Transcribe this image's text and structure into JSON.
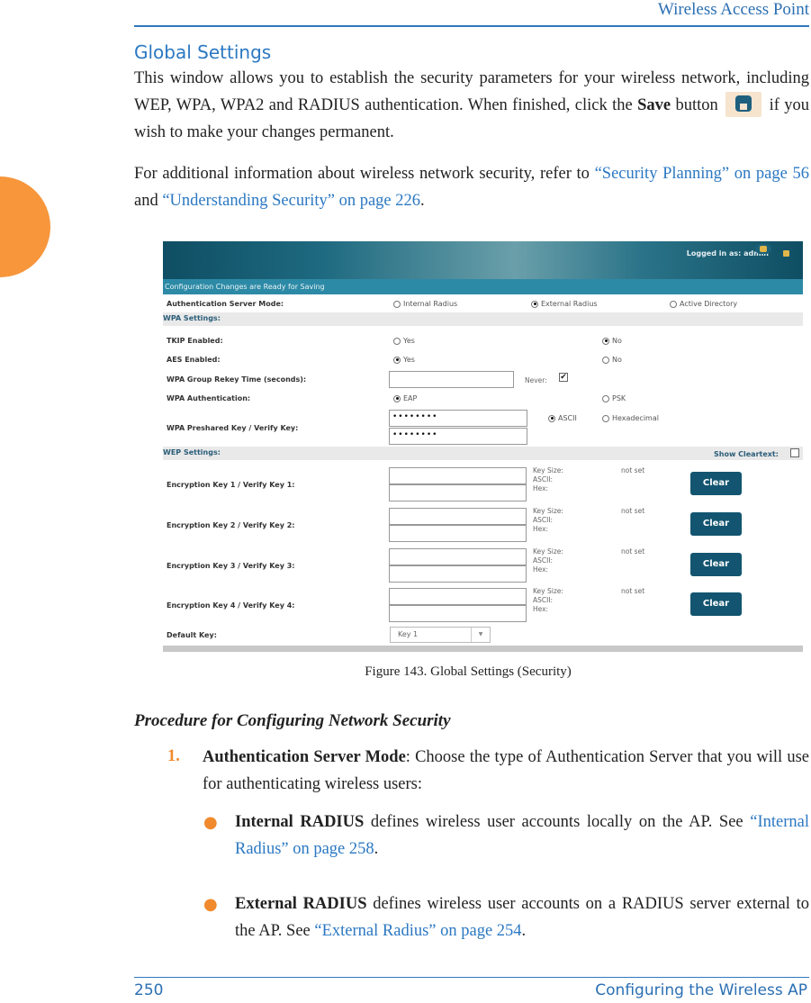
{
  "header": {
    "title": "Wireless Access Point"
  },
  "section_title": "Global Settings",
  "intro": {
    "p1_a": "This window allows you to establish the security parameters for your wireless network, including WEP, WPA, WPA2 and RADIUS authentication. When finished, click the ",
    "p1_save": "Save",
    "p1_b": " button",
    "p1_c": " if you wish to make your changes permanent.",
    "p2_a": "For additional information about wireless network security, refer to ",
    "p2_link1": "“Security Planning” on page 56",
    "p2_b": " and ",
    "p2_link2": "“Understanding Security” on page 226",
    "p2_c": "."
  },
  "figure": {
    "logged_in": "Logged in as: admin",
    "ready_banner": "Configuration Changes are Ready for Saving",
    "auth_mode": {
      "label": "Authentication Server Mode:",
      "options": [
        "Internal Radius",
        "External Radius",
        "Active Directory"
      ],
      "selected": "External Radius"
    },
    "wpa_section": "WPA Settings:",
    "tkip": {
      "label": "TKIP Enabled:",
      "yes": "Yes",
      "no": "No",
      "selected": "No"
    },
    "aes": {
      "label": "AES Enabled:",
      "yes": "Yes",
      "no": "No",
      "selected": "Yes"
    },
    "rekey": {
      "label": "WPA Group Rekey Time (seconds):",
      "value": "",
      "never_label": "Never:",
      "never_checked": true
    },
    "wpa_auth": {
      "label": "WPA Authentication:",
      "options": [
        "EAP",
        "PSK"
      ],
      "selected": "EAP"
    },
    "psk": {
      "label": "WPA Preshared Key / Verify Key:",
      "key": "••••••••",
      "verify": "••••••••",
      "ascii": "ASCII",
      "hex": "Hexadecimal",
      "selected": "ASCII"
    },
    "wep_section": "WEP Settings:",
    "show_cleartext": {
      "label": "Show Cleartext:",
      "checked": false
    },
    "enc_keys": [
      {
        "label": "Encryption Key 1 / Verify Key 1:",
        "key_size": "Key Size:",
        "key_size_value": "not set",
        "ascii": "ASCII:",
        "hex": "Hex:",
        "button": "Clear"
      },
      {
        "label": "Encryption Key 2 / Verify Key 2:",
        "key_size": "Key Size:",
        "key_size_value": "not set",
        "ascii": "ASCII:",
        "hex": "Hex:",
        "button": "Clear"
      },
      {
        "label": "Encryption Key 3 / Verify Key 3:",
        "key_size": "Key Size:",
        "key_size_value": "not set",
        "ascii": "ASCII:",
        "hex": "Hex:",
        "button": "Clear"
      },
      {
        "label": "Encryption Key 4 / Verify Key 4:",
        "key_size": "Key Size:",
        "key_size_value": "not set",
        "ascii": "ASCII:",
        "hex": "Hex:",
        "button": "Clear"
      }
    ],
    "default_key": {
      "label": "Default Key:",
      "value": "Key 1"
    },
    "caption": "Figure 143. Global Settings (Security)"
  },
  "procedure": {
    "title": "Procedure for Configuring Network Security",
    "step1_num": "1.",
    "step1_bold": "Authentication Server Mode",
    "step1_text": ": Choose the type of Authentication Server that you will use for authenticating wireless users:",
    "bullets": [
      {
        "bold": "Internal RADIUS",
        "text": " defines wireless user accounts locally on the AP. See ",
        "link": "“Internal Radius” on page 258",
        "end": "."
      },
      {
        "bold": "External RADIUS",
        "text": " defines wireless user accounts on a RADIUS server external to the AP. See ",
        "link": "“External Radius” on page 254",
        "end": "."
      }
    ]
  },
  "footer": {
    "page": "250",
    "chapter": "Configuring the Wireless AP"
  },
  "colors": {
    "accent_blue": "#2b78c2",
    "accent_orange": "#f7963b",
    "button_teal": "#135570"
  }
}
